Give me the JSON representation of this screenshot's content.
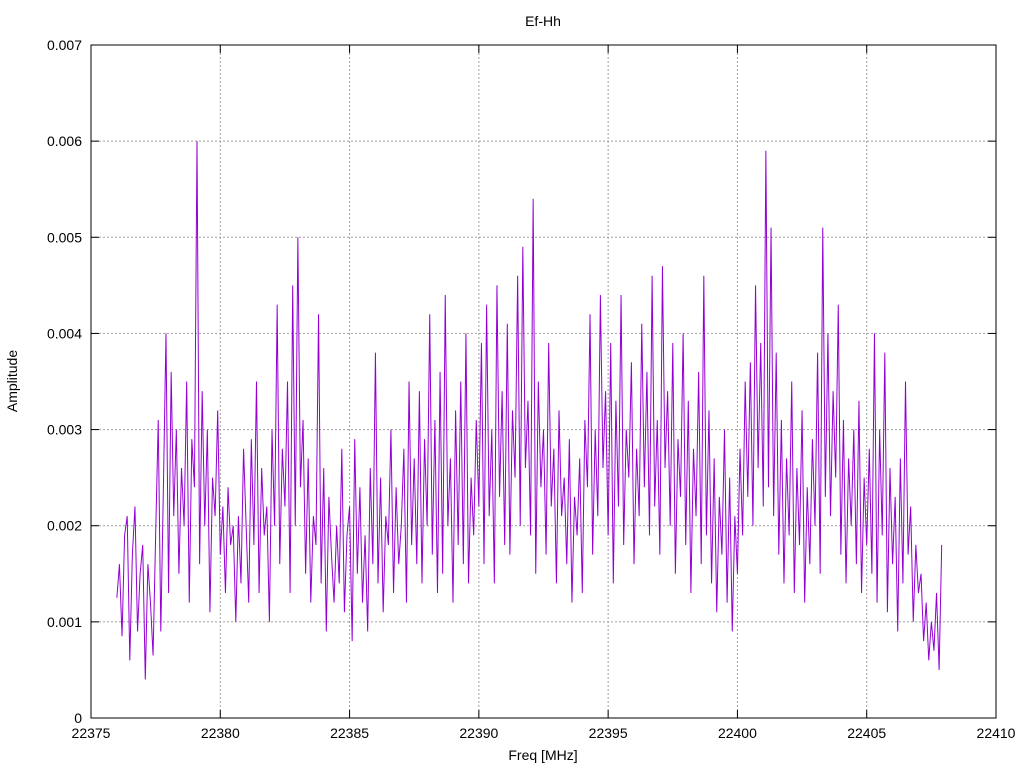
{
  "chart_data": {
    "type": "line",
    "title": "Ef-Hh",
    "xlabel": "Freq [MHz]",
    "ylabel": "Amplitude",
    "xlim": [
      22375,
      22410
    ],
    "ylim": [
      0,
      0.007
    ],
    "xticks": [
      "22375",
      "22380",
      "22385",
      "22390",
      "22395",
      "22400",
      "22405",
      "22410"
    ],
    "yticks": [
      "0",
      "0.001",
      "0.002",
      "0.003",
      "0.004",
      "0.005",
      "0.006",
      "0.007"
    ],
    "grid": true,
    "legend": "none",
    "series": [
      {
        "color": "#9400d3",
        "x_start": 22376.0,
        "x_step": 0.1,
        "values": [
          0.00125,
          0.0016,
          0.00085,
          0.0019,
          0.0021,
          0.0006,
          0.0017,
          0.0022,
          0.0009,
          0.0015,
          0.0018,
          0.0004,
          0.0016,
          0.0012,
          0.00065,
          0.0019,
          0.0031,
          0.0009,
          0.0024,
          0.004,
          0.0013,
          0.0036,
          0.0021,
          0.003,
          0.0015,
          0.0026,
          0.002,
          0.0035,
          0.0012,
          0.0029,
          0.0024,
          0.006,
          0.0016,
          0.0034,
          0.002,
          0.003,
          0.0011,
          0.0025,
          0.0021,
          0.0032,
          0.0017,
          0.0022,
          0.0013,
          0.0024,
          0.0018,
          0.002,
          0.001,
          0.0021,
          0.0014,
          0.0028,
          0.002,
          0.0012,
          0.0029,
          0.0018,
          0.0035,
          0.0013,
          0.0026,
          0.0019,
          0.0022,
          0.001,
          0.003,
          0.002,
          0.0043,
          0.0016,
          0.0028,
          0.0022,
          0.0035,
          0.0013,
          0.0045,
          0.002,
          0.005,
          0.0024,
          0.0031,
          0.0015,
          0.0027,
          0.0012,
          0.0021,
          0.0018,
          0.0042,
          0.0014,
          0.0026,
          0.0009,
          0.0023,
          0.0017,
          0.0012,
          0.002,
          0.0014,
          0.0028,
          0.0011,
          0.0019,
          0.0022,
          0.0008,
          0.0029,
          0.0015,
          0.0024,
          0.0012,
          0.0019,
          0.0009,
          0.0026,
          0.0016,
          0.0038,
          0.0014,
          0.0025,
          0.0011,
          0.0021,
          0.0018,
          0.003,
          0.0013,
          0.0024,
          0.0016,
          0.002,
          0.0028,
          0.0012,
          0.0035,
          0.0018,
          0.0027,
          0.0016,
          0.0034,
          0.0014,
          0.0029,
          0.002,
          0.0042,
          0.0017,
          0.0031,
          0.0013,
          0.0036,
          0.0015,
          0.0044,
          0.002,
          0.0027,
          0.0012,
          0.0032,
          0.0018,
          0.0035,
          0.0016,
          0.004,
          0.0014,
          0.0025,
          0.0019,
          0.0031,
          0.0022,
          0.0039,
          0.0016,
          0.0043,
          0.0021,
          0.003,
          0.0014,
          0.0045,
          0.0023,
          0.0034,
          0.0018,
          0.0041,
          0.0017,
          0.0032,
          0.0025,
          0.0046,
          0.002,
          0.0049,
          0.0026,
          0.0033,
          0.0019,
          0.0054,
          0.0015,
          0.0035,
          0.0024,
          0.003,
          0.0017,
          0.0039,
          0.0022,
          0.0028,
          0.0014,
          0.0032,
          0.0021,
          0.0025,
          0.0016,
          0.0029,
          0.0012,
          0.0023,
          0.0019,
          0.0027,
          0.0013,
          0.0031,
          0.0024,
          0.0042,
          0.0017,
          0.003,
          0.0021,
          0.0044,
          0.0026,
          0.0034,
          0.0019,
          0.0039,
          0.0014,
          0.0033,
          0.0022,
          0.0044,
          0.0018,
          0.003,
          0.0025,
          0.0037,
          0.0016,
          0.0028,
          0.0021,
          0.0041,
          0.0024,
          0.0036,
          0.0019,
          0.0046,
          0.0022,
          0.0031,
          0.0017,
          0.0047,
          0.0026,
          0.0034,
          0.002,
          0.0039,
          0.0015,
          0.0029,
          0.0023,
          0.004,
          0.0018,
          0.0033,
          0.0013,
          0.0028,
          0.0021,
          0.0036,
          0.0016,
          0.0046,
          0.0019,
          0.0032,
          0.0014,
          0.0027,
          0.0011,
          0.0023,
          0.0017,
          0.003,
          0.0012,
          0.0025,
          0.0009,
          0.0021,
          0.0015,
          0.0028,
          0.0019,
          0.0035,
          0.0023,
          0.0037,
          0.002,
          0.0045,
          0.0026,
          0.0039,
          0.0022,
          0.0059,
          0.0024,
          0.0051,
          0.0021,
          0.0038,
          0.0017,
          0.0031,
          0.0014,
          0.0027,
          0.0019,
          0.0035,
          0.0013,
          0.0026,
          0.0018,
          0.0032,
          0.0012,
          0.0024,
          0.0016,
          0.0029,
          0.002,
          0.0038,
          0.0015,
          0.0051,
          0.0023,
          0.004,
          0.0021,
          0.0034,
          0.0025,
          0.0043,
          0.0017,
          0.0031,
          0.0014,
          0.0027,
          0.002,
          0.003,
          0.0016,
          0.0033,
          0.0013,
          0.0025,
          0.0018,
          0.0028,
          0.0015,
          0.004,
          0.0012,
          0.003,
          0.0019,
          0.0038,
          0.0011,
          0.0026,
          0.0016,
          0.0023,
          0.0009,
          0.0027,
          0.0014,
          0.0035,
          0.0017,
          0.0022,
          0.001,
          0.0018,
          0.0013,
          0.0015,
          0.0008,
          0.0012,
          0.0006,
          0.001,
          0.0007,
          0.0013,
          0.0005,
          0.0018
        ]
      }
    ]
  }
}
